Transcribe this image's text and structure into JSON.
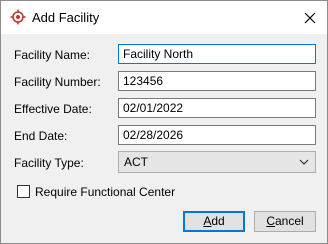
{
  "window": {
    "title": "Add Facility"
  },
  "form": {
    "facility_name": {
      "label": "Facility Name:",
      "value": "Facility North"
    },
    "facility_number": {
      "label": "Facility Number:",
      "value": "123456"
    },
    "effective_date": {
      "label": "Effective Date:",
      "value": "02/01/2022"
    },
    "end_date": {
      "label": "End Date:",
      "value": "02/28/2026"
    },
    "facility_type": {
      "label": "Facility Type:",
      "selected": "ACT"
    },
    "require_functional_center": {
      "label": "Require Functional Center",
      "checked": false
    }
  },
  "buttons": {
    "add": {
      "mnemonic": "A",
      "rest": "dd"
    },
    "cancel": {
      "mnemonic": "C",
      "rest": "ancel"
    }
  },
  "icons": {
    "app": "facility-target-icon",
    "close": "close-icon",
    "dropdown": "chevron-down-icon"
  },
  "colors": {
    "accent": "#0078d7",
    "icon_red": "#c0392b"
  }
}
